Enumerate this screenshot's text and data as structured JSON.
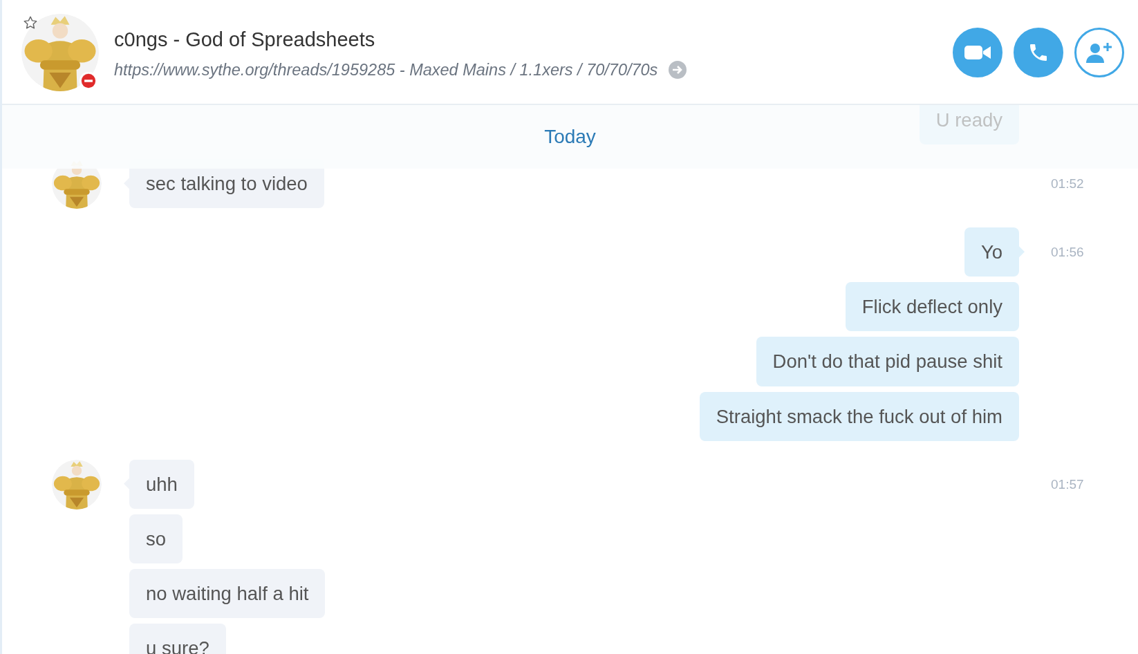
{
  "header": {
    "title": "c0ngs - God of Spreadsheets",
    "subtitle": "https://www.sythe.org/threads/1959285 - Maxed Mains / 1.1xers / 70/70/70s",
    "favorite": false,
    "do_not_disturb": true,
    "buttons": [
      {
        "kind": "video",
        "outlined": false
      },
      {
        "kind": "call",
        "outlined": false
      },
      {
        "kind": "add-person",
        "outlined": true
      }
    ]
  },
  "previous_message": {
    "text": "U ready"
  },
  "day_divider": "Today",
  "groups": [
    {
      "outgoing": false,
      "time": "01:52",
      "messages": [
        "sec talking to video"
      ]
    },
    {
      "outgoing": true,
      "time": "01:56",
      "messages": [
        "Yo",
        "Flick deflect only",
        "Don't do that pid pause shit",
        "Straight smack the fuck out of him"
      ]
    },
    {
      "outgoing": false,
      "time": "01:57",
      "messages": [
        "uhh",
        "so",
        "no waiting half a hit",
        "u sure?"
      ]
    }
  ]
}
